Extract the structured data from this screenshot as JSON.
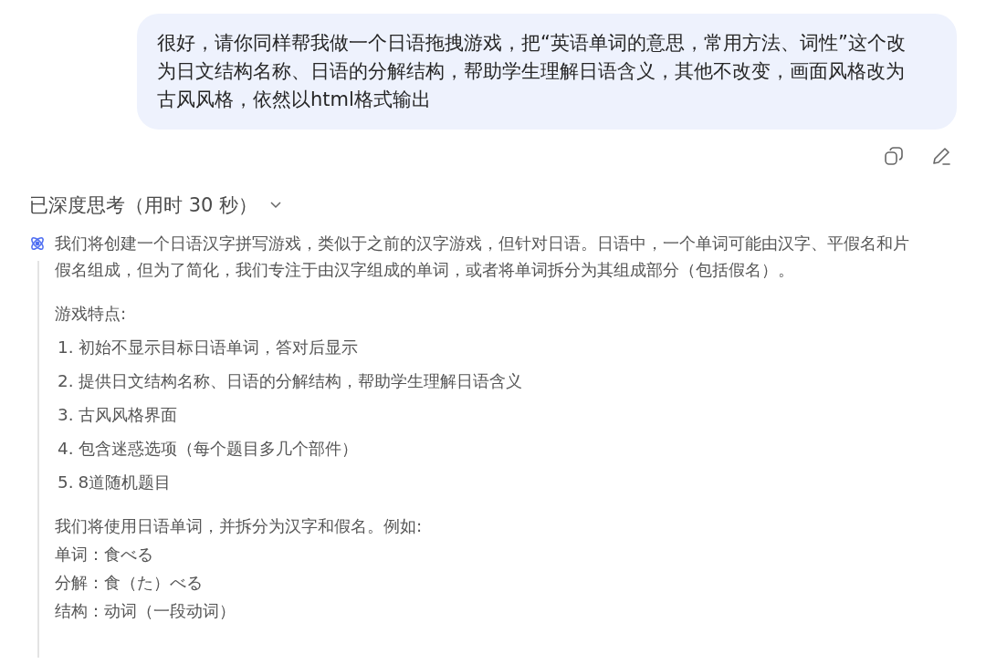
{
  "user_message": {
    "lines": [
      "很好，请你同样帮我做一个日语拖拽游戏，把“英语单词的意思，常用方法、词性”这个改",
      "为日文结构名称、日语的分解结构，帮助学生理解日语含义，其他不改变，画面风格改为",
      "古风风格，依然以html格式输出"
    ]
  },
  "thinking": {
    "title": "已深度思考（用时 30 秒）",
    "expanded": true,
    "intro_lines": [
      "我们将创建一个日语汉字拼写游戏，类似于之前的汉字游戏，但针对日语。日语中，一个单词可能由汉字、平假名和片",
      "假名组成，但为了简化，我们专注于由汉字组成的单词，或者将单词拆分为其组成部分（包括假名）。"
    ],
    "features_heading": "游戏特点:",
    "features": [
      {
        "number": "1.",
        "text": "初始不显示目标日语单词，答对后显示"
      },
      {
        "number": "2.",
        "text": "提供日文结构名称、日语的分解结构，帮助学生理解日语含义"
      },
      {
        "number": "3.",
        "text": "古风风格界面"
      },
      {
        "number": "4.",
        "text": "包含迷惑选项（每个题目多几个部件）"
      },
      {
        "number": "5.",
        "text": "8道随机题目"
      }
    ],
    "example_lines": [
      "我们将使用日语单词，并拆分为汉字和假名。例如:",
      "单词：食べる",
      "分解：食（た）べる",
      "结构：动词（一段动词）"
    ]
  }
}
